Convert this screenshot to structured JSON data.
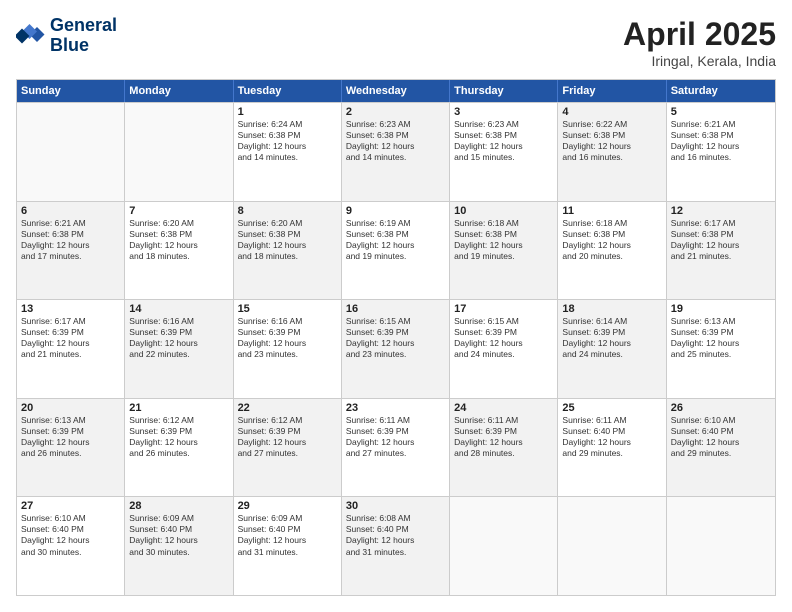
{
  "header": {
    "logo_line1": "General",
    "logo_line2": "Blue",
    "title": "April 2025",
    "location": "Iringal, Kerala, India"
  },
  "days_of_week": [
    "Sunday",
    "Monday",
    "Tuesday",
    "Wednesday",
    "Thursday",
    "Friday",
    "Saturday"
  ],
  "weeks": [
    [
      {
        "day": "",
        "lines": []
      },
      {
        "day": "",
        "lines": []
      },
      {
        "day": "1",
        "lines": [
          "Sunrise: 6:24 AM",
          "Sunset: 6:38 PM",
          "Daylight: 12 hours",
          "and 14 minutes."
        ]
      },
      {
        "day": "2",
        "lines": [
          "Sunrise: 6:23 AM",
          "Sunset: 6:38 PM",
          "Daylight: 12 hours",
          "and 14 minutes."
        ]
      },
      {
        "day": "3",
        "lines": [
          "Sunrise: 6:23 AM",
          "Sunset: 6:38 PM",
          "Daylight: 12 hours",
          "and 15 minutes."
        ]
      },
      {
        "day": "4",
        "lines": [
          "Sunrise: 6:22 AM",
          "Sunset: 6:38 PM",
          "Daylight: 12 hours",
          "and 16 minutes."
        ]
      },
      {
        "day": "5",
        "lines": [
          "Sunrise: 6:21 AM",
          "Sunset: 6:38 PM",
          "Daylight: 12 hours",
          "and 16 minutes."
        ]
      }
    ],
    [
      {
        "day": "6",
        "lines": [
          "Sunrise: 6:21 AM",
          "Sunset: 6:38 PM",
          "Daylight: 12 hours",
          "and 17 minutes."
        ]
      },
      {
        "day": "7",
        "lines": [
          "Sunrise: 6:20 AM",
          "Sunset: 6:38 PM",
          "Daylight: 12 hours",
          "and 18 minutes."
        ]
      },
      {
        "day": "8",
        "lines": [
          "Sunrise: 6:20 AM",
          "Sunset: 6:38 PM",
          "Daylight: 12 hours",
          "and 18 minutes."
        ]
      },
      {
        "day": "9",
        "lines": [
          "Sunrise: 6:19 AM",
          "Sunset: 6:38 PM",
          "Daylight: 12 hours",
          "and 19 minutes."
        ]
      },
      {
        "day": "10",
        "lines": [
          "Sunrise: 6:18 AM",
          "Sunset: 6:38 PM",
          "Daylight: 12 hours",
          "and 19 minutes."
        ]
      },
      {
        "day": "11",
        "lines": [
          "Sunrise: 6:18 AM",
          "Sunset: 6:38 PM",
          "Daylight: 12 hours",
          "and 20 minutes."
        ]
      },
      {
        "day": "12",
        "lines": [
          "Sunrise: 6:17 AM",
          "Sunset: 6:38 PM",
          "Daylight: 12 hours",
          "and 21 minutes."
        ]
      }
    ],
    [
      {
        "day": "13",
        "lines": [
          "Sunrise: 6:17 AM",
          "Sunset: 6:39 PM",
          "Daylight: 12 hours",
          "and 21 minutes."
        ]
      },
      {
        "day": "14",
        "lines": [
          "Sunrise: 6:16 AM",
          "Sunset: 6:39 PM",
          "Daylight: 12 hours",
          "and 22 minutes."
        ]
      },
      {
        "day": "15",
        "lines": [
          "Sunrise: 6:16 AM",
          "Sunset: 6:39 PM",
          "Daylight: 12 hours",
          "and 23 minutes."
        ]
      },
      {
        "day": "16",
        "lines": [
          "Sunrise: 6:15 AM",
          "Sunset: 6:39 PM",
          "Daylight: 12 hours",
          "and 23 minutes."
        ]
      },
      {
        "day": "17",
        "lines": [
          "Sunrise: 6:15 AM",
          "Sunset: 6:39 PM",
          "Daylight: 12 hours",
          "and 24 minutes."
        ]
      },
      {
        "day": "18",
        "lines": [
          "Sunrise: 6:14 AM",
          "Sunset: 6:39 PM",
          "Daylight: 12 hours",
          "and 24 minutes."
        ]
      },
      {
        "day": "19",
        "lines": [
          "Sunrise: 6:13 AM",
          "Sunset: 6:39 PM",
          "Daylight: 12 hours",
          "and 25 minutes."
        ]
      }
    ],
    [
      {
        "day": "20",
        "lines": [
          "Sunrise: 6:13 AM",
          "Sunset: 6:39 PM",
          "Daylight: 12 hours",
          "and 26 minutes."
        ]
      },
      {
        "day": "21",
        "lines": [
          "Sunrise: 6:12 AM",
          "Sunset: 6:39 PM",
          "Daylight: 12 hours",
          "and 26 minutes."
        ]
      },
      {
        "day": "22",
        "lines": [
          "Sunrise: 6:12 AM",
          "Sunset: 6:39 PM",
          "Daylight: 12 hours",
          "and 27 minutes."
        ]
      },
      {
        "day": "23",
        "lines": [
          "Sunrise: 6:11 AM",
          "Sunset: 6:39 PM",
          "Daylight: 12 hours",
          "and 27 minutes."
        ]
      },
      {
        "day": "24",
        "lines": [
          "Sunrise: 6:11 AM",
          "Sunset: 6:39 PM",
          "Daylight: 12 hours",
          "and 28 minutes."
        ]
      },
      {
        "day": "25",
        "lines": [
          "Sunrise: 6:11 AM",
          "Sunset: 6:40 PM",
          "Daylight: 12 hours",
          "and 29 minutes."
        ]
      },
      {
        "day": "26",
        "lines": [
          "Sunrise: 6:10 AM",
          "Sunset: 6:40 PM",
          "Daylight: 12 hours",
          "and 29 minutes."
        ]
      }
    ],
    [
      {
        "day": "27",
        "lines": [
          "Sunrise: 6:10 AM",
          "Sunset: 6:40 PM",
          "Daylight: 12 hours",
          "and 30 minutes."
        ]
      },
      {
        "day": "28",
        "lines": [
          "Sunrise: 6:09 AM",
          "Sunset: 6:40 PM",
          "Daylight: 12 hours",
          "and 30 minutes."
        ]
      },
      {
        "day": "29",
        "lines": [
          "Sunrise: 6:09 AM",
          "Sunset: 6:40 PM",
          "Daylight: 12 hours",
          "and 31 minutes."
        ]
      },
      {
        "day": "30",
        "lines": [
          "Sunrise: 6:08 AM",
          "Sunset: 6:40 PM",
          "Daylight: 12 hours",
          "and 31 minutes."
        ]
      },
      {
        "day": "",
        "lines": []
      },
      {
        "day": "",
        "lines": []
      },
      {
        "day": "",
        "lines": []
      }
    ]
  ]
}
